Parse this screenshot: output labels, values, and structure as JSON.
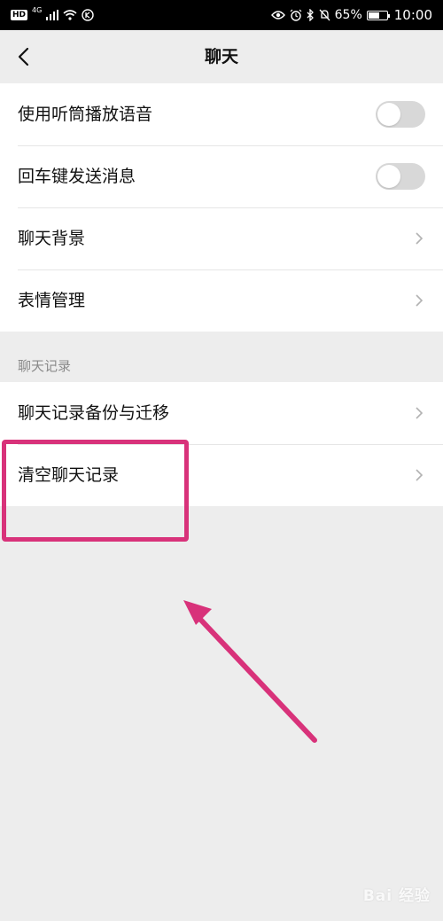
{
  "status_bar": {
    "hd": "HD",
    "network": "4G",
    "battery_percent": "65%",
    "battery_level": 0.65,
    "time": "10:00"
  },
  "header": {
    "title": "聊天"
  },
  "settings_group_1": {
    "items": [
      {
        "label": "使用听筒播放语音",
        "control": "toggle",
        "on": false
      },
      {
        "label": "回车键发送消息",
        "control": "toggle",
        "on": false
      },
      {
        "label": "聊天背景",
        "control": "chevron"
      },
      {
        "label": "表情管理",
        "control": "chevron"
      }
    ]
  },
  "section_chat_history": {
    "title": "聊天记录",
    "items": [
      {
        "label": "聊天记录备份与迁移",
        "control": "chevron"
      },
      {
        "label": "清空聊天记录",
        "control": "chevron"
      }
    ]
  },
  "annotation": {
    "highlight_color": "#d8327a",
    "highlight_target": "清空聊天记录"
  },
  "watermark": {
    "text": "Bai 经验"
  },
  "colors": {
    "background": "#ededed",
    "toggle_off": "#d8d8d8",
    "accent": "#d8327a"
  }
}
